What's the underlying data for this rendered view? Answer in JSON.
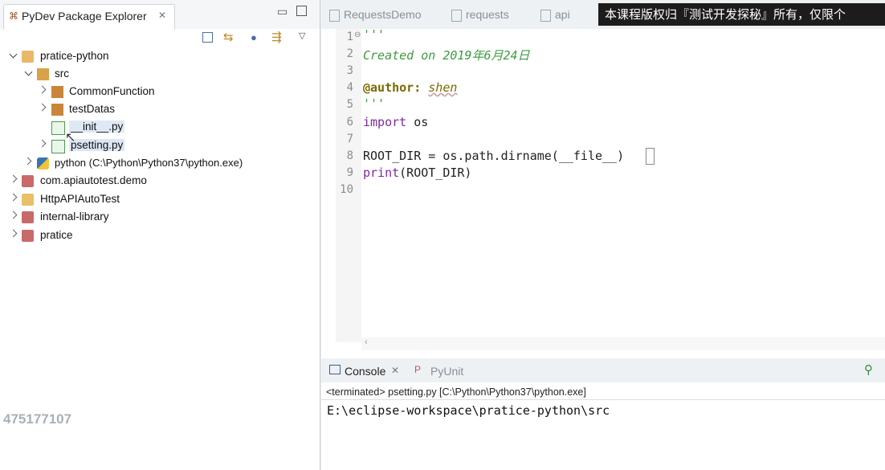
{
  "explorer": {
    "tab_title": "PyDev Package Explorer",
    "tree": [
      {
        "label": "pratice-python"
      },
      {
        "label": "src"
      },
      {
        "label": "CommonFunction"
      },
      {
        "label": "testDatas"
      },
      {
        "label": "__init__.py"
      },
      {
        "label": "psetting.py"
      },
      {
        "label": "python  (C:\\Python\\Python37\\python.exe)"
      },
      {
        "label": "com.apiautotest.demo"
      },
      {
        "label": "HttpAPIAutoTest"
      },
      {
        "label": "internal-library"
      },
      {
        "label": "pratice"
      }
    ]
  },
  "editor": {
    "tabs": [
      "RequestsDemo",
      "requests",
      "api"
    ],
    "line_numbers": [
      "1",
      "2",
      "3",
      "4",
      "5",
      "6",
      "7",
      "8",
      "9",
      "10"
    ],
    "code": {
      "l1": "'''",
      "l2": "Created on 2019年6月24日",
      "l4_tag": "@author:",
      "l4_name": "shen",
      "l5": "'''",
      "l6_kw": "import",
      "l6_rest": " os",
      "l8": "ROOT_DIR = os.path.dirname(__file__)",
      "l9_kw": "print",
      "l9_rest": "(ROOT_DIR)"
    }
  },
  "console": {
    "tab_console": "Console",
    "tab_pyunit": "PyUnit",
    "status": "<terminated> psetting.py [C:\\Python\\Python37\\python.exe]",
    "output": "E:\\eclipse-workspace\\pratice-python\\src"
  },
  "overlay": {
    "banner": "本课程版权归『测试开发探秘』所有，仅限个",
    "watermark": "475177107"
  },
  "colors": {
    "keyword": "#7a2aa0",
    "docstring": "#3f9c3f",
    "decorator": "#7a6a00"
  }
}
